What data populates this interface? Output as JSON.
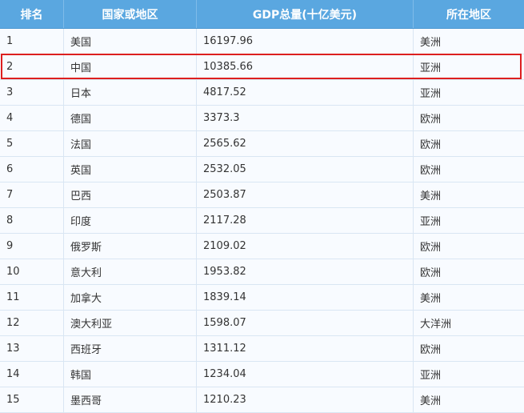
{
  "columns": [
    "排名",
    "国家或地区",
    "GDP总量(十亿美元)",
    "所在地区"
  ],
  "rows": [
    [
      "1",
      "美国",
      "16197.96",
      "美洲"
    ],
    [
      "2",
      "中国",
      "10385.66",
      "亚洲"
    ],
    [
      "3",
      "日本",
      "4817.52",
      "亚洲"
    ],
    [
      "4",
      "德国",
      "3373.3",
      "欧洲"
    ],
    [
      "5",
      "法国",
      "2565.62",
      "欧洲"
    ],
    [
      "6",
      "英国",
      "2532.05",
      "欧洲"
    ],
    [
      "7",
      "巴西",
      "2503.87",
      "美洲"
    ],
    [
      "8",
      "印度",
      "2117.28",
      "亚洲"
    ],
    [
      "9",
      "俄罗斯",
      "2109.02",
      "欧洲"
    ],
    [
      "10",
      "意大利",
      "1953.82",
      "欧洲"
    ],
    [
      "11",
      "加拿大",
      "1839.14",
      "美洲"
    ],
    [
      "12",
      "澳大利亚",
      "1598.07",
      "大洋洲"
    ],
    [
      "13",
      "西班牙",
      "1311.12",
      "欧洲"
    ],
    [
      "14",
      "韩国",
      "1234.04",
      "亚洲"
    ],
    [
      "15",
      "墨西哥",
      "1210.23",
      "美洲"
    ]
  ],
  "highlighted_rank": "2",
  "colors": {
    "header_bg": "#5aa7e0",
    "highlight_border": "#dd1f1f",
    "row_bg": "#f8fbff",
    "grid": "#d9e6f3"
  }
}
